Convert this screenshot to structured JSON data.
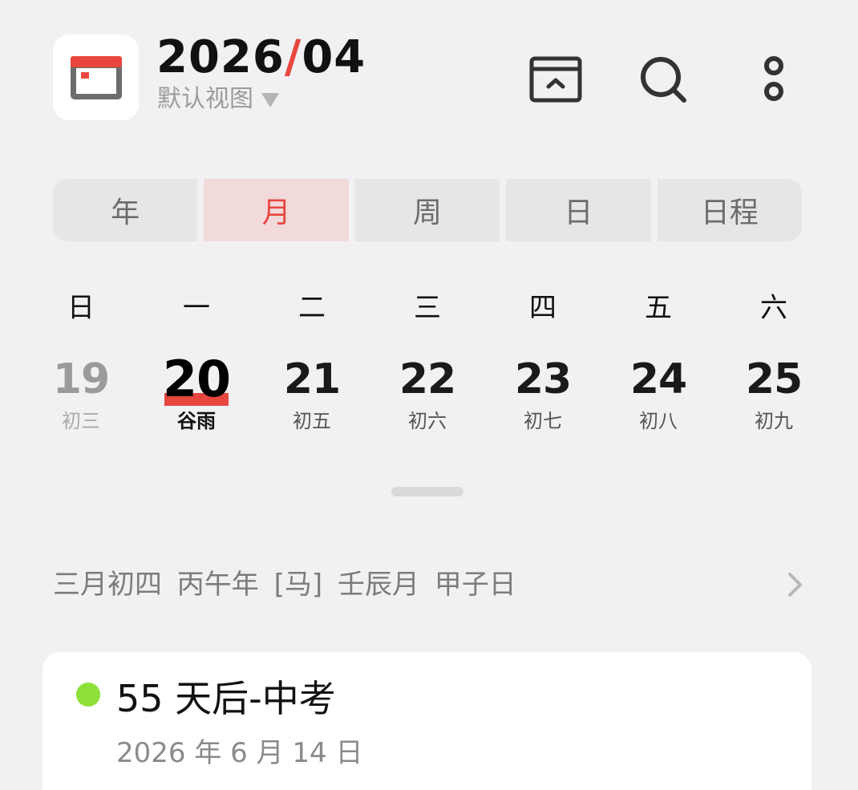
{
  "header": {
    "year": "2026",
    "separator": "/",
    "month": "04",
    "view_selector": "默认视图"
  },
  "icons": {
    "app": "calendar-app-icon",
    "fold": "collapse-view-icon",
    "search": "search-icon",
    "more": "more-options-icon"
  },
  "tabs": [
    "年",
    "月",
    "周",
    "日",
    "日程"
  ],
  "active_tab": "月",
  "weekdays": [
    "日",
    "一",
    "二",
    "三",
    "四",
    "五",
    "六"
  ],
  "days": [
    {
      "day": "19",
      "lunar": "初三"
    },
    {
      "day": "20",
      "lunar": "谷雨"
    },
    {
      "day": "21",
      "lunar": "初五"
    },
    {
      "day": "22",
      "lunar": "初六"
    },
    {
      "day": "23",
      "lunar": "初七"
    },
    {
      "day": "24",
      "lunar": "初八"
    },
    {
      "day": "25",
      "lunar": "初九"
    }
  ],
  "lunar_info": "三月初四  丙午年 [马] 壬辰月 甲子日",
  "event": {
    "title": "55 天后-中考",
    "date": "2026 年 6 月 14 日",
    "color": "#8fe03b"
  },
  "colors": {
    "accent": "#e8473f",
    "background": "#f1f1f3"
  }
}
